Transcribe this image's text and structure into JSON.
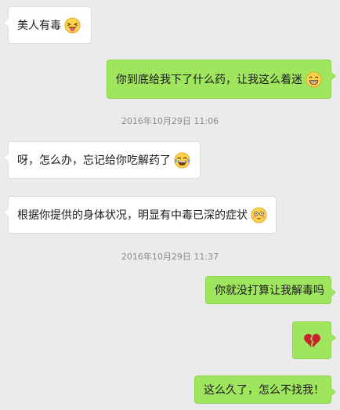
{
  "messages": [
    {
      "direction": "incoming",
      "text": "美人有毒",
      "emoji": "tongue-out-emoji"
    },
    {
      "direction": "outgoing",
      "text": "你到底给我下了什么药，让我这么着迷",
      "emoji": "grin-emoji"
    },
    {
      "direction": "incoming",
      "text": "呀，怎么办，忘记给你吃解药了",
      "emoji": "tears-of-joy-emoji"
    },
    {
      "direction": "incoming",
      "text": "根据你提供的身体状况，明显有中毒已深的症状",
      "emoji": "flushed-emoji"
    },
    {
      "direction": "outgoing",
      "text": "你就没打算让我解毒吗"
    },
    {
      "direction": "outgoing",
      "text": "",
      "emoji": "broken-heart-icon"
    },
    {
      "direction": "outgoing",
      "text": "这么久了，怎么不找我！"
    }
  ],
  "timestamps": [
    "2016年10月29日 11:06",
    "2016年10月29日 11:37"
  ],
  "colors": {
    "background": "#ebebeb",
    "incoming_bubble": "#ffffff",
    "outgoing_bubble": "#9fe55e",
    "timestamp_text": "#8a8a8a",
    "broken_heart": "#c8232c"
  }
}
